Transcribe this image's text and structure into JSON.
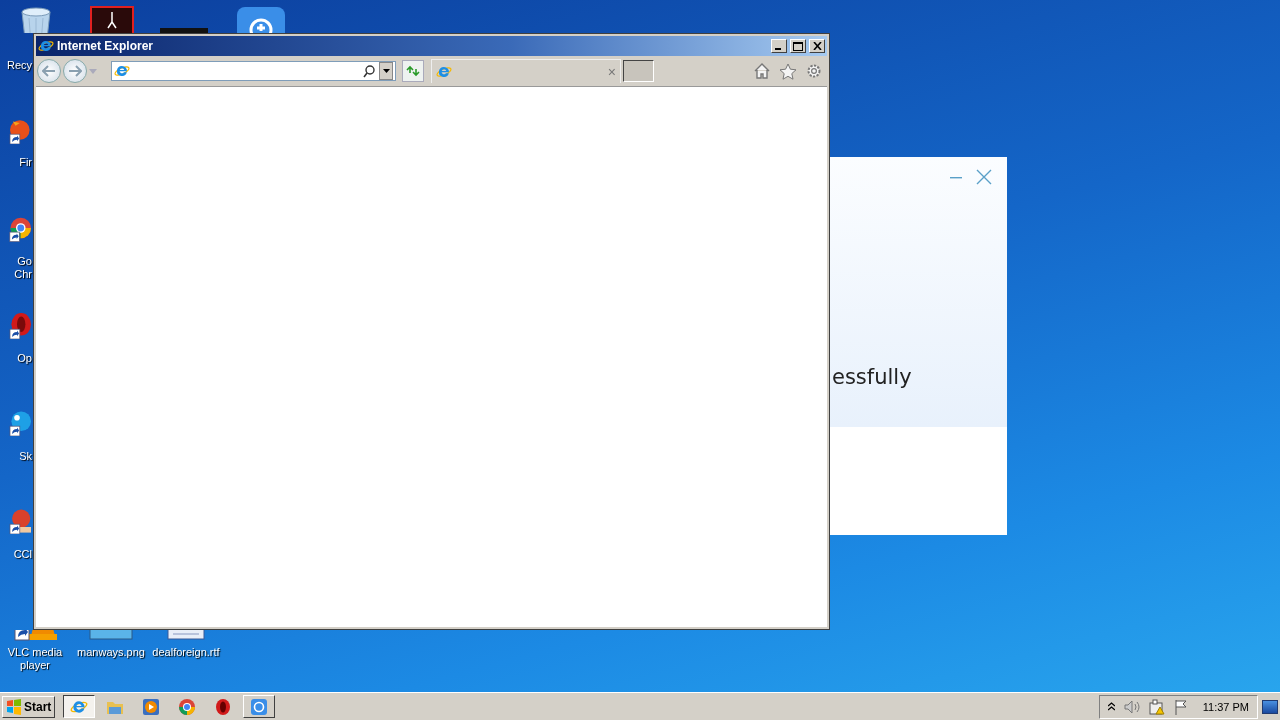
{
  "desktop_icons": [
    {
      "kind": "recycle",
      "lines": [
        "Recy"
      ]
    },
    {
      "kind": "acrobat"
    },
    {
      "kind": "dark"
    },
    {
      "kind": "blueapp"
    },
    {
      "kind": "firefox",
      "lines": [
        "Fir"
      ]
    },
    {
      "kind": "chrome",
      "lines": [
        "Go",
        "Chr"
      ]
    },
    {
      "kind": "opera",
      "lines": [
        "Op"
      ]
    },
    {
      "kind": "skype",
      "lines": [
        "Sk"
      ]
    },
    {
      "kind": "ccleaner",
      "lines": [
        "CCl"
      ]
    },
    {
      "kind": "vlc",
      "lines": [
        "VLC media",
        "player"
      ]
    },
    {
      "kind": "image",
      "lines": [
        "manways.png"
      ]
    },
    {
      "kind": "document",
      "lines": [
        "dealforeign.rtf"
      ]
    }
  ],
  "background_dialog": {
    "text": "essfully"
  },
  "browser": {
    "title": "Internet Explorer",
    "tab": {
      "close": "×"
    }
  },
  "taskbar": {
    "start": "Start",
    "items": [
      {
        "kind": "ie",
        "selected": true,
        "open": true
      },
      {
        "kind": "folder",
        "selected": false,
        "open": false
      },
      {
        "kind": "player",
        "selected": false,
        "open": false
      },
      {
        "kind": "chrome",
        "selected": false,
        "open": false
      },
      {
        "kind": "opera",
        "selected": false,
        "open": false
      },
      {
        "kind": "blueapp",
        "selected": false,
        "open": true
      }
    ],
    "clock": "11:37 PM"
  }
}
